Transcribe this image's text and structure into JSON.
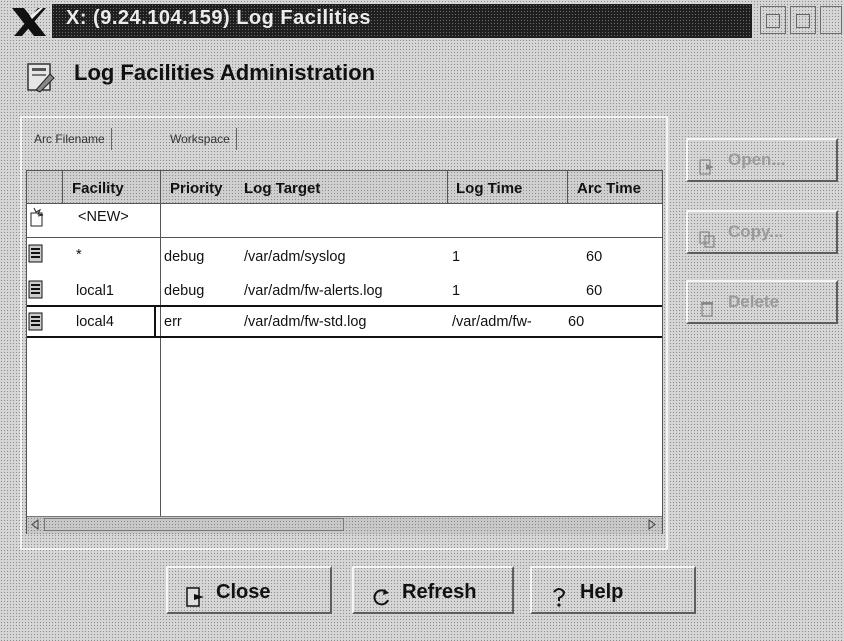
{
  "window": {
    "title": "X: (9.24.104.159) Log Facilities",
    "buttons": [
      "minimize-icon",
      "maximize-icon",
      "close-icon"
    ]
  },
  "header": {
    "title": "Log Facilities Administration",
    "icon": "admin-document-icon"
  },
  "tabs": [
    {
      "label": "Arc Filename"
    },
    {
      "label": "Workspace"
    }
  ],
  "table": {
    "columns": [
      "Facility",
      "Priority",
      "Log Target",
      "Log Time",
      "Arc Time"
    ],
    "new_row": {
      "facility": "<NEW>",
      "icon": "new-entry-icon"
    },
    "rows": [
      {
        "icon": "facility-icon",
        "facility": "*",
        "priority": "debug",
        "target": "/var/adm/syslog",
        "log_time": "1",
        "arc_time": "60"
      },
      {
        "icon": "facility-icon",
        "facility": "local1",
        "priority": "debug",
        "target": "/var/adm/fw-alerts.log",
        "log_time": "1",
        "arc_time": "60"
      },
      {
        "icon": "facility-icon",
        "facility": "local4",
        "priority": "err",
        "target": "/var/adm/fw-std.log",
        "log_time": "/var/adm/fw-",
        "arc_time": "60"
      }
    ]
  },
  "side_buttons": {
    "open": "Open...",
    "copy": "Copy...",
    "delete": "Delete"
  },
  "bottom_buttons": {
    "close": "Close",
    "refresh": "Refresh",
    "help": "Help"
  }
}
